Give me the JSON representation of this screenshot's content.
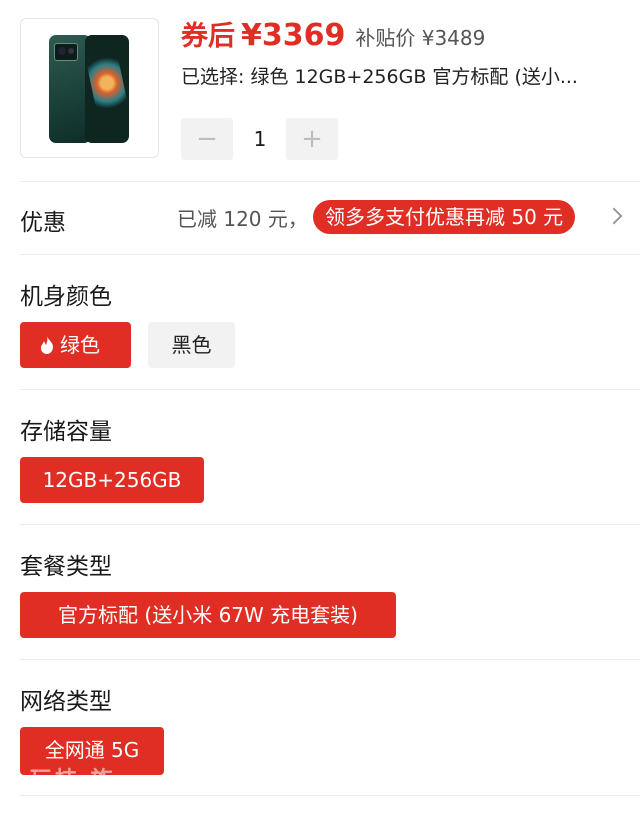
{
  "product": {
    "coupon_label": "券后",
    "coupon_price": "¥3369",
    "subsidy_label": "补贴价 ¥3489",
    "selected": "已选择: 绿色 12GB+256GB 官方标配 (送小...",
    "quantity": "1",
    "minus": "−",
    "plus": "+"
  },
  "discount": {
    "title": "优惠",
    "reduced": "已减 120 元，",
    "promo": "领多多支付优惠再减 50 元"
  },
  "color": {
    "title": "机身颜色",
    "options": [
      "绿色",
      "黑色"
    ],
    "selected": "绿色"
  },
  "storage": {
    "title": "存储容量",
    "options": [
      "12GB+256GB"
    ]
  },
  "package": {
    "title": "套餐类型",
    "options": [
      "官方标配 (送小米 67W 充电套装)"
    ]
  },
  "network": {
    "title": "网络类型",
    "options": [
      "全网通 5G"
    ]
  },
  "watermark": "玩技 族",
  "colors": {
    "accent": "#e02e24",
    "chip_inactive": "#f2f2f2",
    "stepper_bg": "#f2f2f2"
  },
  "icons": [
    "flame-icon",
    "chevron-right-icon"
  ]
}
